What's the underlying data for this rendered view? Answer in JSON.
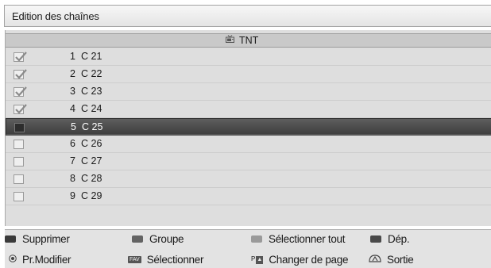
{
  "window": {
    "title": "Edition des chaînes"
  },
  "group": {
    "label": "TNT",
    "icon": "tv-icon"
  },
  "channels": [
    {
      "number": "1",
      "name": "C 21",
      "checked": true,
      "selected": false
    },
    {
      "number": "2",
      "name": "C 22",
      "checked": true,
      "selected": false
    },
    {
      "number": "3",
      "name": "C 23",
      "checked": true,
      "selected": false
    },
    {
      "number": "4",
      "name": "C 24",
      "checked": true,
      "selected": false
    },
    {
      "number": "5",
      "name": "C 25",
      "checked": false,
      "selected": true
    },
    {
      "number": "6",
      "name": "C 26",
      "checked": false,
      "selected": false
    },
    {
      "number": "7",
      "name": "C 27",
      "checked": false,
      "selected": false
    },
    {
      "number": "8",
      "name": "C 28",
      "checked": false,
      "selected": false
    },
    {
      "number": "9",
      "name": "C 29",
      "checked": false,
      "selected": false
    }
  ],
  "legend": {
    "row1": [
      {
        "label": "Supprimer",
        "key": "red-key",
        "color": "#3a3a3a"
      },
      {
        "label": "Groupe",
        "key": "green-key",
        "color": "#636363"
      },
      {
        "label": "Sélectionner tout",
        "key": "yellow-key",
        "color": "#9a9a9a"
      },
      {
        "label": "Dép.",
        "key": "blue-key",
        "color": "#4a4a4a"
      }
    ],
    "row2": [
      {
        "label": "Pr.Modifier",
        "icon": "ok-icon"
      },
      {
        "label": "Sélectionner",
        "icon": "fav-icon",
        "badge": "FAV"
      },
      {
        "label": "Changer de page",
        "icon": "page-icon",
        "badge": "P"
      },
      {
        "label": "Sortie",
        "icon": "exit-icon"
      }
    ]
  }
}
